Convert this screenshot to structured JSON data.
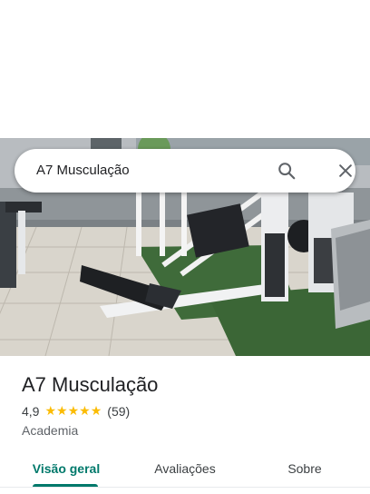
{
  "search": {
    "query": "A7 Musculação",
    "search_icon": "search-icon",
    "close_icon": "close-icon"
  },
  "hero": {
    "description_icon": "gym-photo"
  },
  "place": {
    "name": "A7 Musculação",
    "rating": "4,9",
    "stars": 5,
    "reviews": "(59)",
    "category": "Academia"
  },
  "tabs": [
    {
      "label": "Visão geral",
      "active": true
    },
    {
      "label": "Avaliações",
      "active": false
    },
    {
      "label": "Sobre",
      "active": false
    }
  ],
  "colors": {
    "accent": "#00796b",
    "star": "#fbbc04",
    "text_primary": "#202124",
    "text_secondary": "#5f6368"
  }
}
